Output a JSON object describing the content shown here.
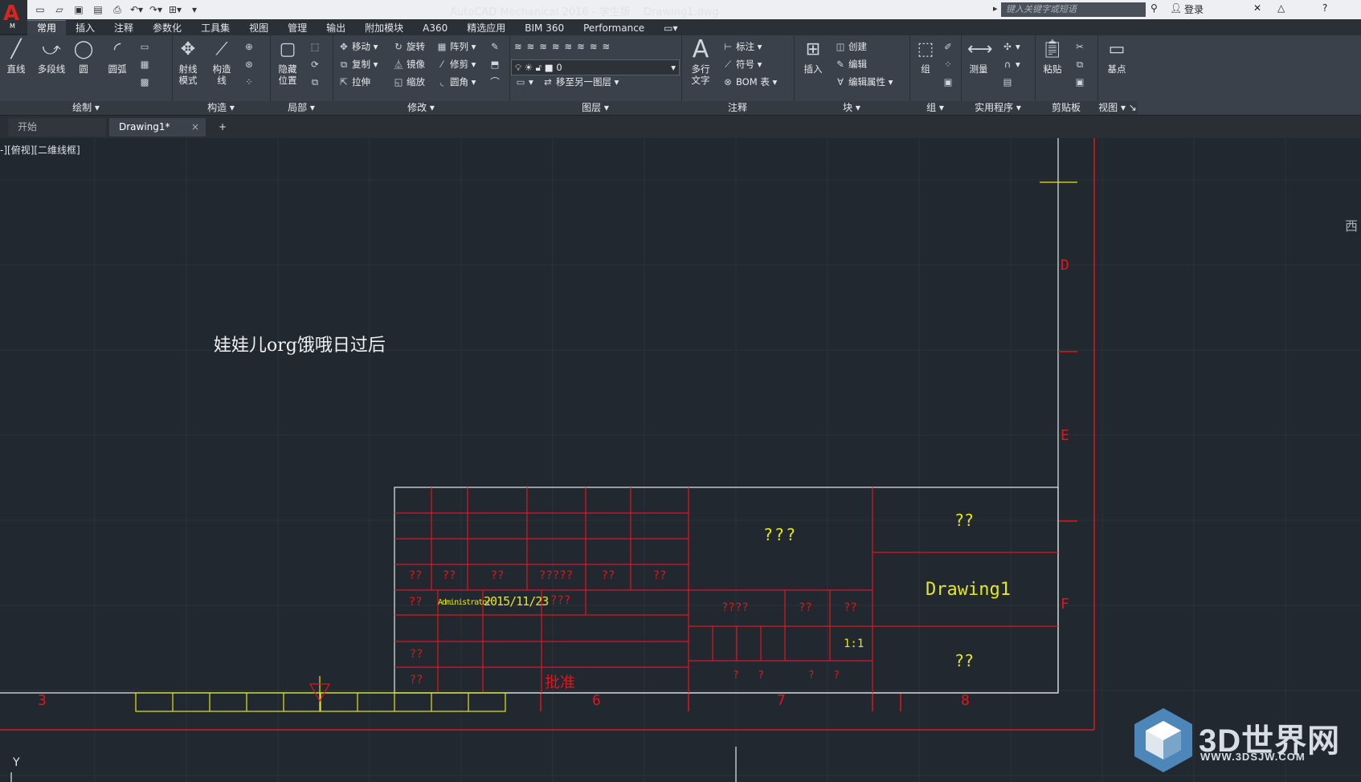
{
  "titlebar": {
    "app_title": "AutoCAD Mechanical 2016 - 学生版    Drawing1.dwg",
    "search_placeholder": "键入关键字或短语",
    "login": "登录"
  },
  "ribbon_tabs": [
    "常用",
    "插入",
    "注释",
    "参数化",
    "工具集",
    "视图",
    "管理",
    "输出",
    "附加模块",
    "A360",
    "精选应用",
    "BIM 360",
    "Performance"
  ],
  "ribbon": {
    "draw": {
      "title": "绘制",
      "line": "直线",
      "polyline": "多段线",
      "circle": "圆",
      "arc": "圆弧"
    },
    "construct": {
      "title": "构造",
      "ray": "射线\n模式",
      "construct": "构造\n线"
    },
    "detail": {
      "title": "局部",
      "hide": "隐藏\n位置"
    },
    "modify": {
      "title": "修改",
      "move": "移动",
      "rotate": "旋转",
      "array": "阵列",
      "copy": "复制",
      "mirror": "镜像",
      "trim": "修剪",
      "stretch": "拉伸",
      "scale": "缩放",
      "fillet": "圆角"
    },
    "layers": {
      "title": "图层",
      "current_layer": "0",
      "move_to_layer": "移至另一图层"
    },
    "annotation": {
      "title": "注释",
      "mtext": "多行\n文字",
      "dimension": "标注",
      "symbol": "符号",
      "bom": "BOM 表"
    },
    "block": {
      "title": "块",
      "insert": "插入",
      "create": "创建",
      "edit": "编辑",
      "edit_attr": "编辑属性"
    },
    "group": {
      "title": "组",
      "group": "组"
    },
    "utilities": {
      "title": "实用程序",
      "measure": "测量"
    },
    "clipboard": {
      "title": "剪贴板",
      "paste": "粘贴"
    },
    "view": {
      "title": "视图",
      "basepoint": "基点"
    }
  },
  "file_tabs": {
    "start": "开始",
    "drawing": "Drawing1*",
    "new": "+"
  },
  "viewport_label": "-][俯视][二维线框]",
  "viewcube_label": "西",
  "sheet_text": "娃娃儿org饿哦日过后",
  "title_block": {
    "cells_row1": [
      "??",
      "??",
      "??",
      "?????",
      "??",
      "??"
    ],
    "designer": "??",
    "author": "Administrator",
    "date": "2015/11/23",
    "approver_q": "???",
    "big_q": "???",
    "left_q1": "??",
    "left_q2": "??",
    "approve": "批准",
    "mid_q1": "????",
    "mid_q2": "??",
    "mid_q3": "??",
    "scale": "1:1",
    "bottom_q": "?   ?       ?   ?",
    "right_top": "??",
    "drawing_name": "Drawing1",
    "right_bottom": "??"
  },
  "zone_labels": {
    "d": "D",
    "e": "E",
    "f": "F",
    "n3": "3",
    "n6": "6",
    "n7": "7",
    "n8": "8"
  },
  "ucs_label": "Y",
  "watermark": {
    "title": "3D世界网",
    "sub": "WWW.3DSJW.COM"
  },
  "colors": {
    "canvas": "#212830",
    "red": "#e0161c",
    "yellow": "#e6e619"
  }
}
